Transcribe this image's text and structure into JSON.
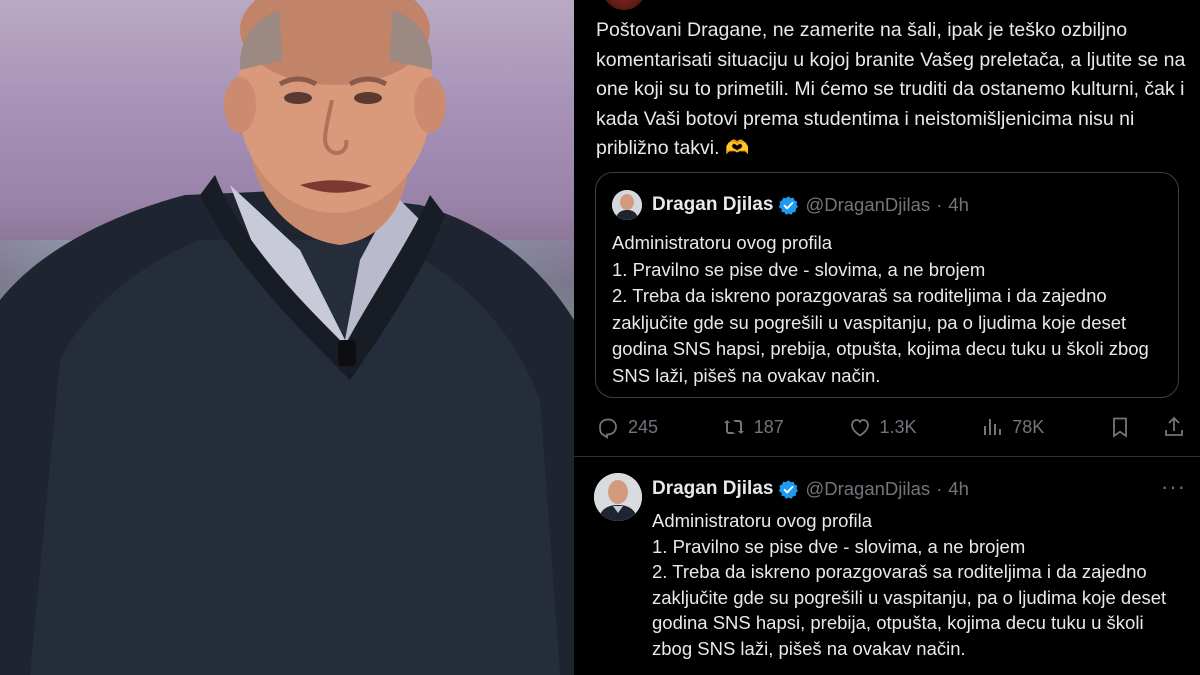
{
  "post": {
    "text": "Poštovani Dragane, ne zamerite na šali, ipak je teško ozbiljno komentarisati situaciju u kojoj branite Vašeg preletača, a ljutite se na one koji su to primetili. Mi ćemo se truditi da ostanemo kulturni, čak i kada Vaši botovi prema studentima i neistomišljenicima nisu ni približno takvi.",
    "emoji": "🫶"
  },
  "quote": {
    "name": "Dragan Djilas",
    "handle": "@DraganDjilas",
    "dot": "·",
    "time": "4h",
    "lines": [
      "Administratoru ovog profila",
      "1. Pravilno se pise dve -  slovima, a ne brojem",
      "2. Treba da iskreno porazgovaraš sa roditeljima i da zajedno zaključite gde su pogrešili u vaspitanju, pa o ljudima koje deset godina SNS hapsi, prebija, otpušta, kojima decu tuku u školi zbog SNS laži, pišeš na ovakav način."
    ]
  },
  "actions": {
    "replies": "245",
    "reposts": "187",
    "likes": "1.3K",
    "views": "78K"
  },
  "reply": {
    "name": "Dragan Djilas",
    "handle": "@DraganDjilas",
    "dot": "·",
    "time": "4h",
    "more": "···",
    "lines": [
      "Administratoru ovog profila",
      "1. Pravilno se pise dve - slovima, a ne brojem",
      "2. Treba da iskreno porazgovaraš sa roditeljima i da zajedno zaključite gde su pogrešili u vaspitanju, pa o ljudima koje deset godina SNS hapsi, prebija, otpušta, kojima decu tuku u školi zbog SNS laži, pišeš na ovakav način."
    ]
  },
  "colors": {
    "background": "#000000",
    "text": "#e7e9ea",
    "muted": "#71767b",
    "verified": "#1d9bf0",
    "border": "#2f3336"
  },
  "icons": [
    "reply-icon",
    "repost-icon",
    "like-icon",
    "views-icon",
    "bookmark-icon",
    "share-icon",
    "verified-badge-icon",
    "more-icon"
  ]
}
